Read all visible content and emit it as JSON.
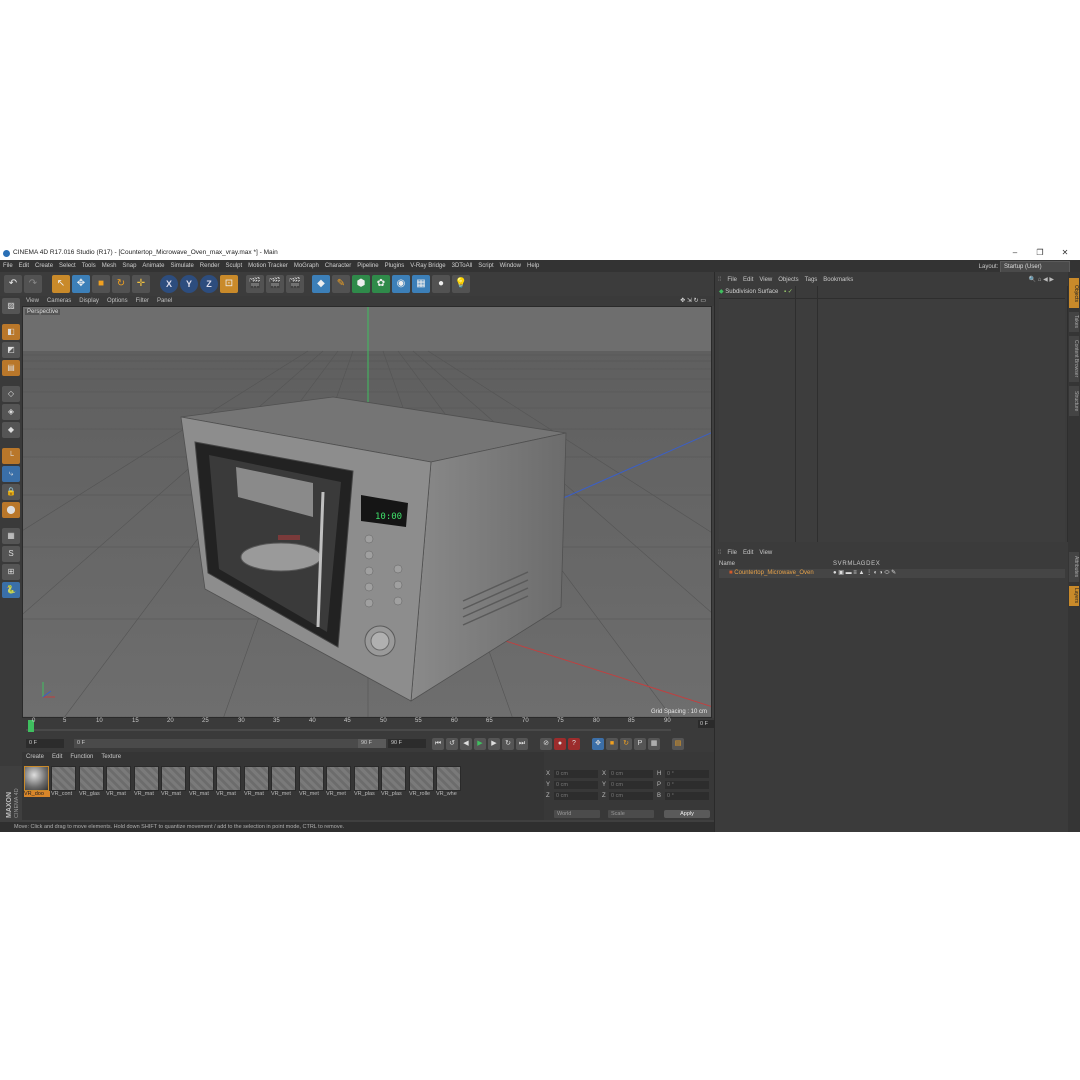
{
  "window": {
    "title": "CINEMA 4D R17.016 Studio (R17) - [Countertop_Microwave_Oven_max_vray.max *] - Main",
    "controls": [
      "–",
      "❐",
      "✕"
    ]
  },
  "menubar": {
    "items": [
      "File",
      "Edit",
      "Create",
      "Select",
      "Tools",
      "Mesh",
      "Snap",
      "Animate",
      "Simulate",
      "Render",
      "Sculpt",
      "Motion Tracker",
      "MoGraph",
      "Character",
      "Pipeline",
      "Plugins",
      "V-Ray Bridge",
      "3DToAll",
      "Script",
      "Window",
      "Help"
    ],
    "layout_label": "Layout:",
    "layout_value": "Startup (User)"
  },
  "toolbar": {
    "undo_icon": "↶",
    "redo_icon": "↷",
    "axis_x": "X",
    "axis_y": "Y",
    "axis_z": "Z"
  },
  "viewport": {
    "menu": [
      "View",
      "Cameras",
      "Display",
      "Options",
      "Filter",
      "Panel"
    ],
    "camera_label": "Perspective",
    "grid_spacing": "Grid Spacing : 10 cm",
    "microwave_display": "10:00"
  },
  "timeline": {
    "ticks": [
      "0",
      "5",
      "10",
      "15",
      "20",
      "25",
      "30",
      "35",
      "40",
      "45",
      "50",
      "55",
      "60",
      "65",
      "70",
      "75",
      "80",
      "85",
      "90"
    ],
    "current_frame": "0 F"
  },
  "playback": {
    "start": "0 F",
    "min": "0 F",
    "max": "90 F",
    "end": "90 F"
  },
  "materials": {
    "menu": [
      "Create",
      "Edit",
      "Function",
      "Texture"
    ],
    "items": [
      "VR_doo",
      "VR_cont",
      "VR_glas",
      "VR_mat",
      "VR_mat",
      "VR_mat",
      "VR_mat",
      "VR_mat",
      "VR_mat",
      "VR_met",
      "VR_met",
      "VR_met",
      "VR_plas",
      "VR_plas",
      "VR_rolle",
      "VR_whe"
    ]
  },
  "coordinates": {
    "rows": [
      {
        "a": "X",
        "av": "0 cm",
        "b": "X",
        "bv": "0 cm",
        "c": "H",
        "cv": "0 °"
      },
      {
        "a": "Y",
        "av": "0 cm",
        "b": "Y",
        "bv": "0 cm",
        "c": "P",
        "cv": "0 °"
      },
      {
        "a": "Z",
        "av": "0 cm",
        "b": "Z",
        "bv": "0 cm",
        "c": "B",
        "cv": "0 °"
      }
    ],
    "world_dropdown": "World",
    "scale_dropdown": "Scale",
    "apply": "Apply"
  },
  "logo": {
    "line1": "MAXON",
    "line2": "CINEMA 4D"
  },
  "status": "Move: Click and drag to move elements. Hold down SHIFT to quantize movement / add to the selection in point mode, CTRL to remove.",
  "objects_panel": {
    "menu": [
      "File",
      "Edit",
      "View",
      "Objects",
      "Tags",
      "Bookmarks"
    ],
    "top_object": "Subdivision Surface"
  },
  "layers_panel": {
    "menu": [
      "File",
      "Edit",
      "View"
    ],
    "name_header": "Name",
    "flags": "S  V  R  M  L  A  G  D  E  X",
    "row_name": "Countertop_Microwave_Oven"
  },
  "side_tabs": [
    "Objects",
    "Takes",
    "Content Browser",
    "Structure",
    "Attributes",
    "Layers"
  ],
  "colors": {
    "accent_orange": "#d9862a",
    "axis_blue": "#3c7fb8",
    "background": "#3f3f3f"
  }
}
